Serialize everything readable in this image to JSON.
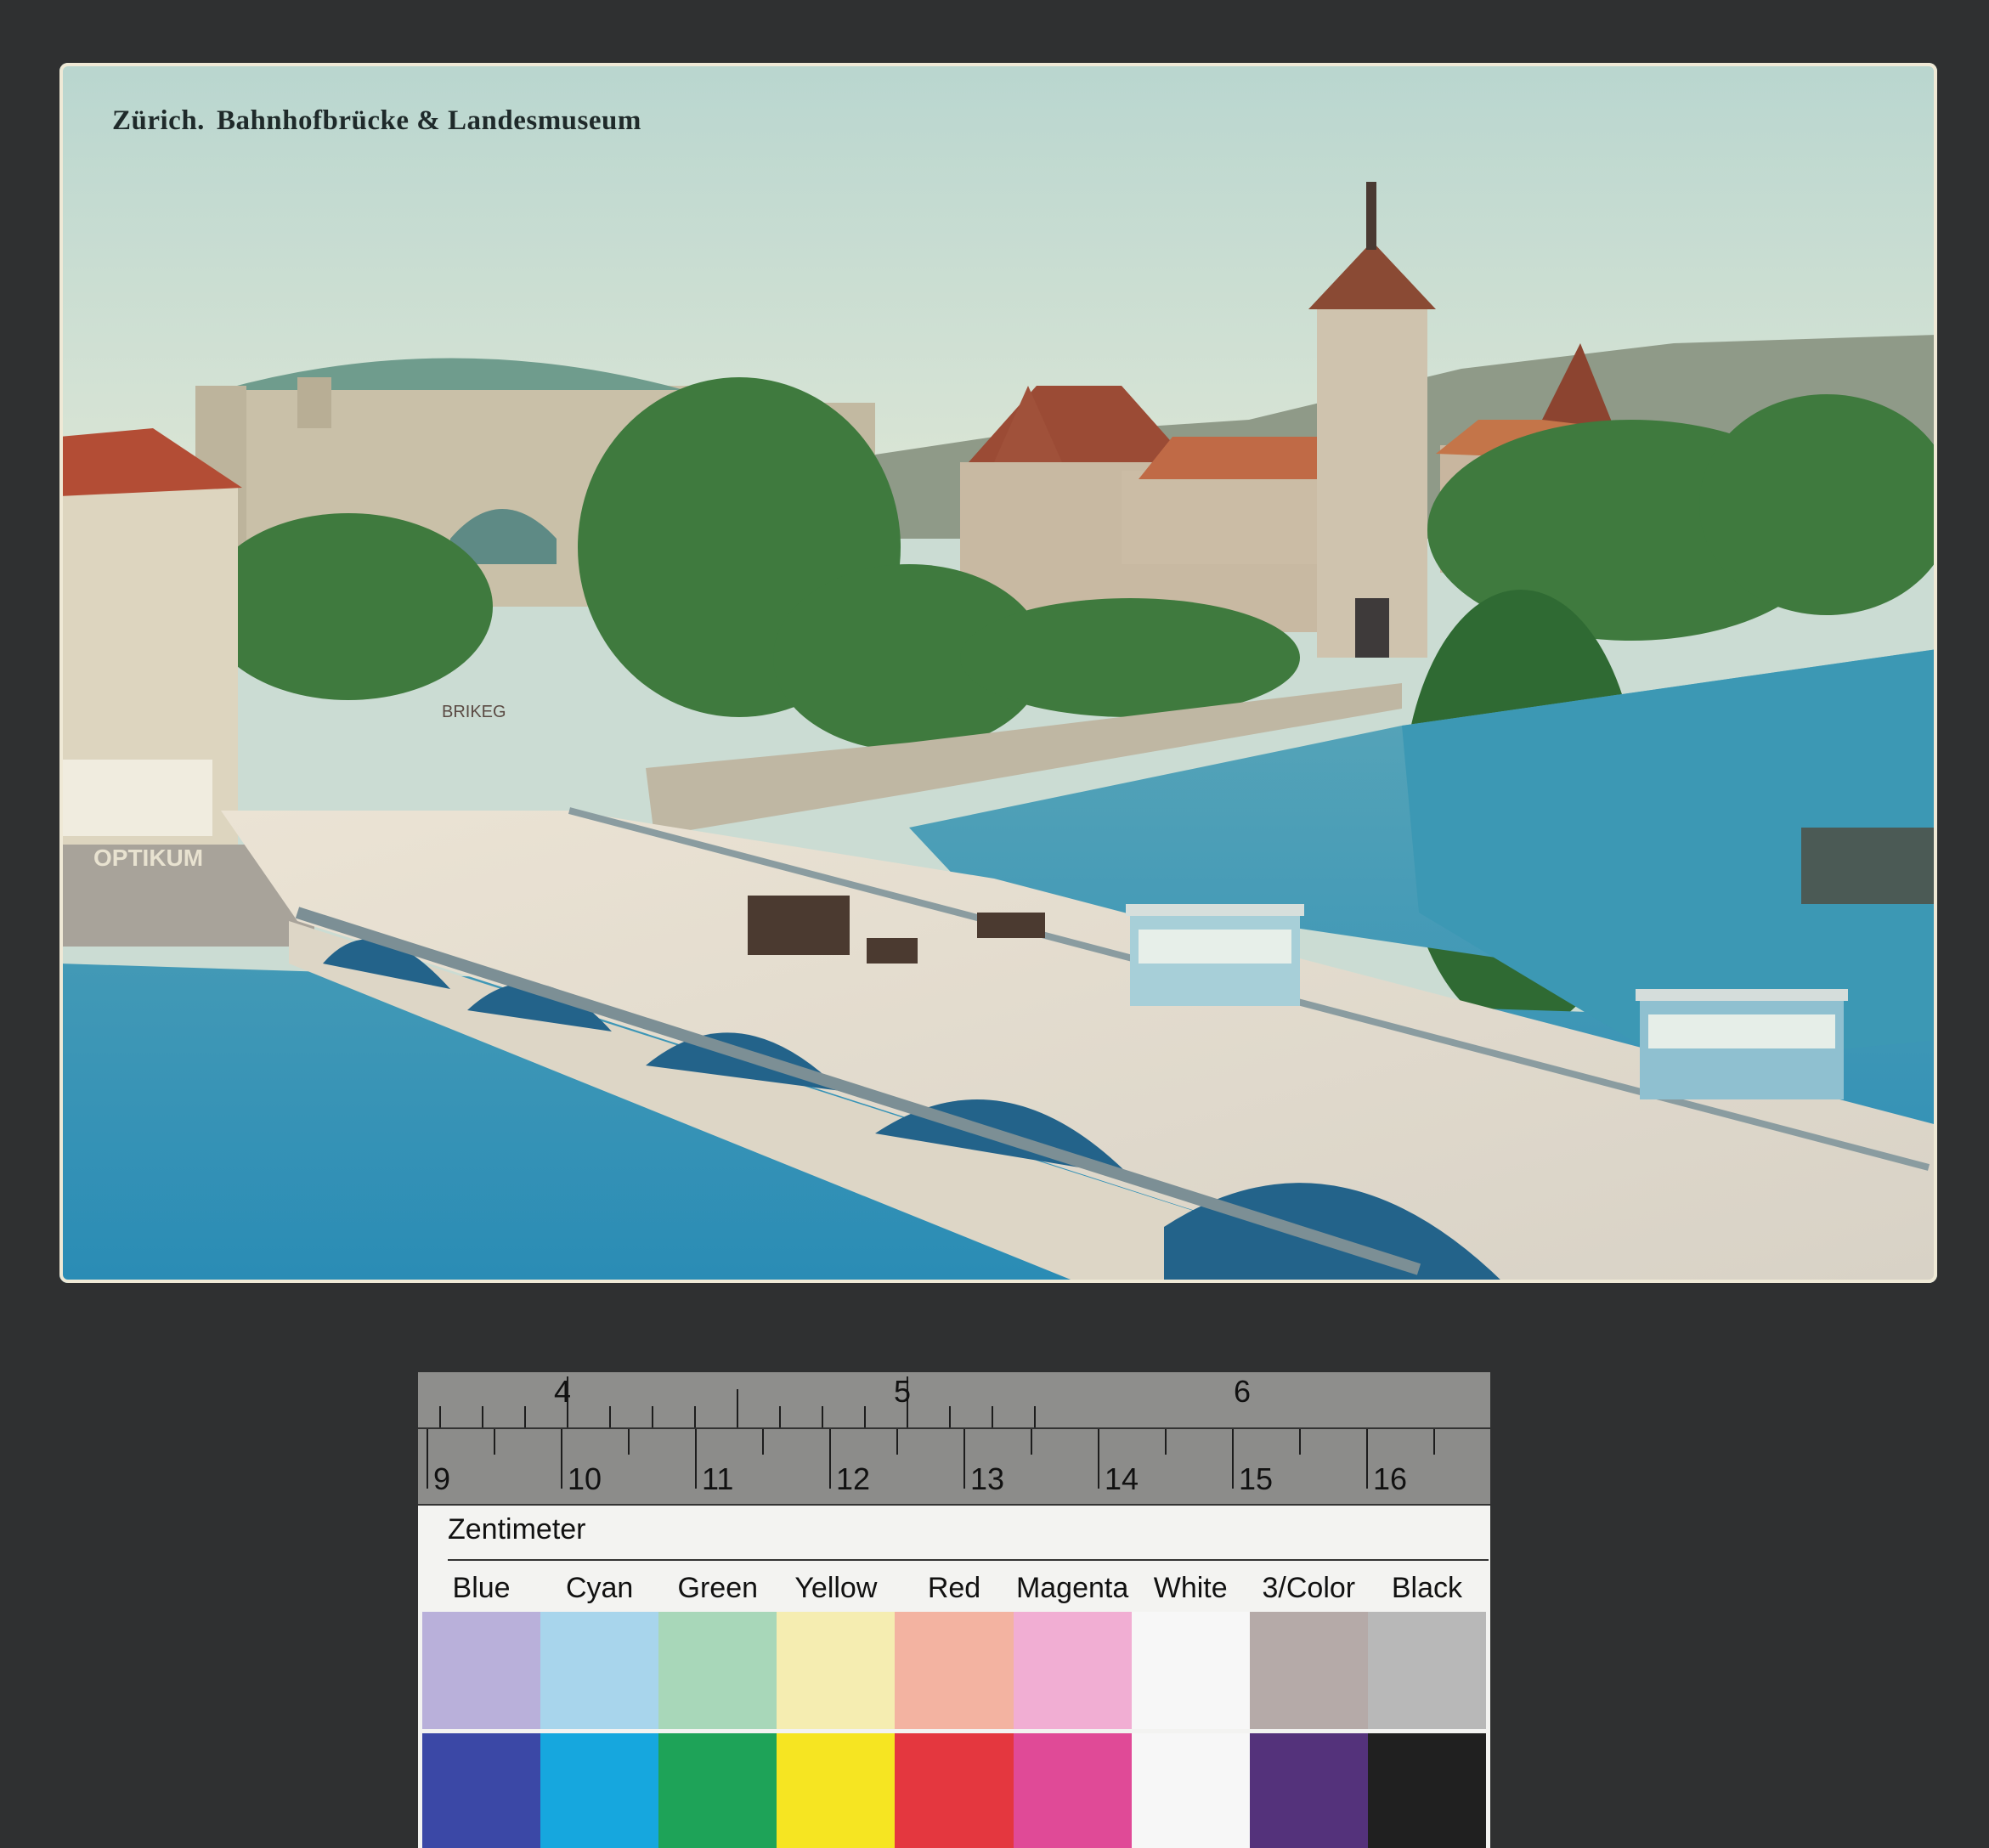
{
  "postcard": {
    "title_city": "Zürich.",
    "title_subject": "Bahnhofbrücke & Landesmuseum",
    "sign_text": "OPTIKUM",
    "banner_text": "BRIKEG"
  },
  "ruler": {
    "inch_numbers": [
      "4",
      "5",
      "6"
    ],
    "cm_numbers": [
      "9",
      "10",
      "11",
      "12",
      "13",
      "14",
      "15",
      "16"
    ],
    "unit_label": "Zentimeter"
  },
  "color_target": {
    "names": [
      "Blue",
      "Cyan",
      "Green",
      "Yellow",
      "Red",
      "Magenta",
      "White",
      "3/Color",
      "Black"
    ],
    "light_colors": [
      "#b9b0da",
      "#a8d5ec",
      "#a8d7b9",
      "#f5edb1",
      "#f3b3a1",
      "#f1aed3",
      "#f7f7f7",
      "#b5aaa8",
      "#b8b8b8"
    ],
    "dark_colors": [
      "#3b48a6",
      "#16a7de",
      "#1ea358",
      "#f6e522",
      "#e4373f",
      "#e04a97",
      "#f7f7f7",
      "#54327b",
      "#202020"
    ]
  }
}
